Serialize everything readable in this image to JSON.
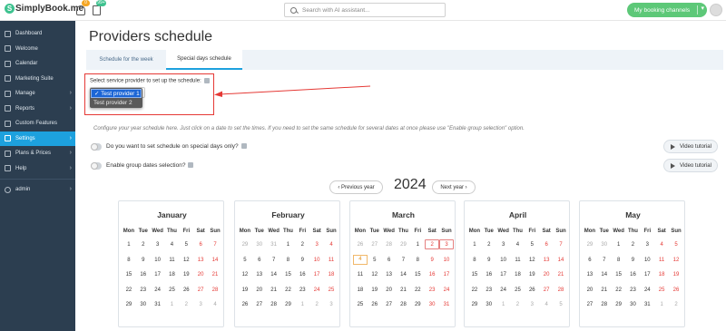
{
  "brand": {
    "name": "SimplyBook.me",
    "notif_badge": "0",
    "tasks_badge": "99+"
  },
  "search": {
    "placeholder": "Search with AI assistant..."
  },
  "channels_button": "My booking channels",
  "sidebar": {
    "items": [
      {
        "label": "Dashboard",
        "icon": "dashboard-icon",
        "chev": false
      },
      {
        "label": "Welcome",
        "icon": "welcome-icon",
        "chev": false
      },
      {
        "label": "Calendar",
        "icon": "calendar-icon",
        "chev": false
      },
      {
        "label": "Marketing Suite",
        "icon": "marketing-icon",
        "chev": false
      },
      {
        "label": "Manage",
        "icon": "manage-icon",
        "chev": true
      },
      {
        "label": "Reports",
        "icon": "reports-icon",
        "chev": true
      },
      {
        "label": "Custom Features",
        "icon": "puzzle-icon",
        "chev": false
      },
      {
        "label": "Settings",
        "icon": "gear-icon",
        "chev": true,
        "active": true
      },
      {
        "label": "Plans & Prices",
        "icon": "cart-icon",
        "chev": true
      },
      {
        "label": "Help",
        "icon": "help-icon",
        "chev": true
      }
    ],
    "user": "admin"
  },
  "page": {
    "title": "Providers schedule",
    "tabs": [
      "Schedule for the week",
      "Special days schedule"
    ],
    "active_tab": 1,
    "provider_label": "Select service provider to set up the schedule:",
    "provider_options": [
      "✓ Test provider 1",
      "Test provider 2"
    ],
    "hint": "Configure your year schedule here. Just click on a date to set the times. If you need to set the same schedule for several dates at once please use \"Enable group selection\" option.",
    "q1": "Do you want to set schedule on special days only?",
    "q2": "Enable group dates selection?",
    "video_tutorial": "Video tutorial",
    "prev_year": "Previous year",
    "next_year": "Next year",
    "year": "2024"
  },
  "weekdays": [
    "Mon",
    "Tue",
    "Wed",
    "Thu",
    "Fri",
    "Sat",
    "Sun"
  ],
  "months": [
    {
      "name": "January",
      "rows": [
        [
          "1",
          "2",
          "3",
          "4",
          "5",
          "6",
          "7"
        ],
        [
          "8",
          "9",
          "10",
          "11",
          "12",
          "13",
          "14"
        ],
        [
          "15",
          "16",
          "17",
          "18",
          "19",
          "20",
          "21"
        ],
        [
          "22",
          "23",
          "24",
          "25",
          "26",
          "27",
          "28"
        ],
        [
          "29",
          "30",
          "31",
          "1",
          "2",
          "3",
          "4"
        ]
      ],
      "muted_last": 4
    },
    {
      "name": "February",
      "rows": [
        [
          "29",
          "30",
          "31",
          "1",
          "2",
          "3",
          "4"
        ],
        [
          "5",
          "6",
          "7",
          "8",
          "9",
          "10",
          "11"
        ],
        [
          "12",
          "13",
          "14",
          "15",
          "16",
          "17",
          "18"
        ],
        [
          "19",
          "20",
          "21",
          "22",
          "23",
          "24",
          "25"
        ],
        [
          "26",
          "27",
          "28",
          "29",
          "1",
          "2",
          "3"
        ]
      ],
      "muted_first": 3,
      "muted_last": 3
    },
    {
      "name": "March",
      "rows": [
        [
          "26",
          "27",
          "28",
          "29",
          "1",
          "2",
          "3"
        ],
        [
          "4",
          "5",
          "6",
          "7",
          "8",
          "9",
          "10"
        ],
        [
          "11",
          "12",
          "13",
          "14",
          "15",
          "16",
          "17"
        ],
        [
          "18",
          "19",
          "20",
          "21",
          "22",
          "23",
          "24"
        ],
        [
          "25",
          "26",
          "27",
          "28",
          "29",
          "30",
          "31"
        ]
      ],
      "muted_first": 4
    },
    {
      "name": "April",
      "rows": [
        [
          "1",
          "2",
          "3",
          "4",
          "5",
          "6",
          "7"
        ],
        [
          "8",
          "9",
          "10",
          "11",
          "12",
          "13",
          "14"
        ],
        [
          "15",
          "16",
          "17",
          "18",
          "19",
          "20",
          "21"
        ],
        [
          "22",
          "23",
          "24",
          "25",
          "26",
          "27",
          "28"
        ],
        [
          "29",
          "30",
          "1",
          "2",
          "3",
          "4",
          "5"
        ]
      ],
      "muted_last": 5
    },
    {
      "name": "May",
      "rows": [
        [
          "29",
          "30",
          "1",
          "2",
          "3",
          "4",
          "5"
        ],
        [
          "6",
          "7",
          "8",
          "9",
          "10",
          "11",
          "12"
        ],
        [
          "13",
          "14",
          "15",
          "16",
          "17",
          "18",
          "19"
        ],
        [
          "20",
          "21",
          "22",
          "23",
          "24",
          "25",
          "26"
        ],
        [
          "27",
          "28",
          "29",
          "30",
          "31",
          "1",
          "2"
        ]
      ],
      "muted_first": 2,
      "muted_last": 2
    }
  ]
}
